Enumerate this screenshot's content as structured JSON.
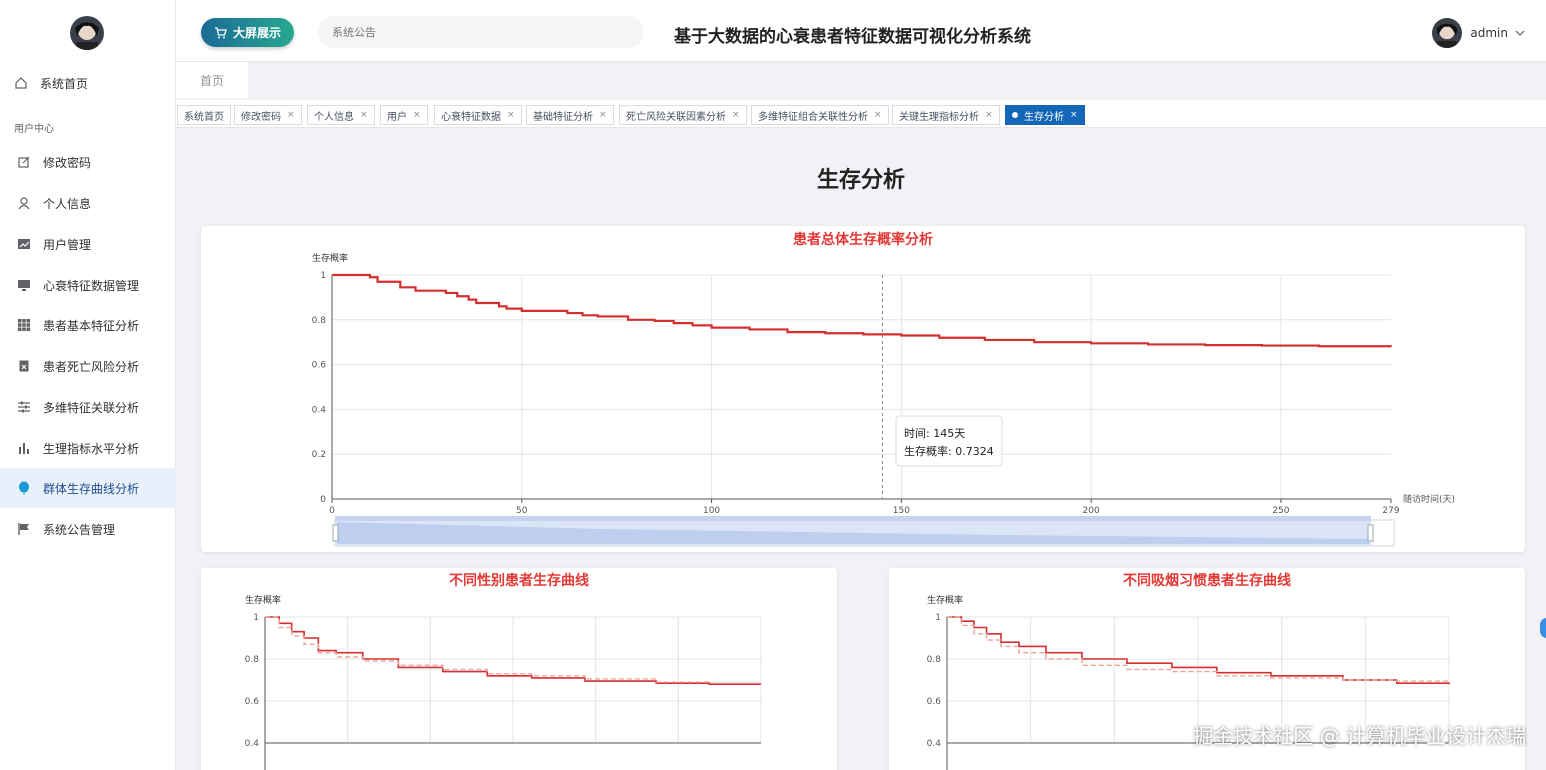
{
  "app": {
    "title": "基于大数据的心衰患者特征数据可视化分析系统",
    "bigscreen_label": "大屏展示",
    "notice_placeholder": "系统公告",
    "user": "admin",
    "home_tab": "首页",
    "page_title": "生存分析",
    "watermark": "掘金技术社区 @ 计算机毕业设计杰瑞"
  },
  "sidebar": {
    "group_label": "用户中心",
    "items": [
      {
        "label": "系统首页",
        "icon": "home-icon"
      },
      {
        "label": "修改密码",
        "icon": "edit-icon"
      },
      {
        "label": "个人信息",
        "icon": "user-icon"
      },
      {
        "label": "用户管理",
        "icon": "chart-line-icon"
      },
      {
        "label": "心衰特征数据管理",
        "icon": "monitor-icon"
      },
      {
        "label": "患者基本特征分析",
        "icon": "grid-icon"
      },
      {
        "label": "患者死亡风险分析",
        "icon": "clipboard-icon"
      },
      {
        "label": "多维特征关联分析",
        "icon": "sliders-icon"
      },
      {
        "label": "生理指标水平分析",
        "icon": "bar-chart-icon"
      },
      {
        "label": "群体生存曲线分析",
        "icon": "balloon-icon"
      },
      {
        "label": "系统公告管理",
        "icon": "flag-icon"
      }
    ],
    "active_index": 9
  },
  "tags": [
    {
      "label": "系统首页",
      "closable": false
    },
    {
      "label": "修改密码",
      "closable": true
    },
    {
      "label": "个人信息",
      "closable": true
    },
    {
      "label": "用户",
      "closable": true
    },
    {
      "label": "心衰特征数据",
      "closable": true
    },
    {
      "label": "基础特征分析",
      "closable": true
    },
    {
      "label": "死亡风险关联因素分析",
      "closable": true
    },
    {
      "label": "多维特征组合关联性分析",
      "closable": true
    },
    {
      "label": "关键生理指标分析",
      "closable": true
    },
    {
      "label": "生存分析",
      "closable": true,
      "active": true
    }
  ],
  "colors": {
    "accent": "#1466b8",
    "curve_red": "#d32f2f",
    "curve_dashed": "#e8a5a0",
    "title_red": "#e53935"
  },
  "chart_data": [
    {
      "type": "line",
      "title": "患者总体生存概率分析",
      "ylabel": "生存概率",
      "xlabel": "随访时间(天)",
      "xlim": [
        0,
        279
      ],
      "ylim": [
        0,
        1
      ],
      "xticks": [
        0,
        50,
        100,
        150,
        200,
        250,
        279
      ],
      "yticks": [
        0,
        0.2,
        0.4,
        0.6,
        0.8,
        1
      ],
      "series": [
        {
          "x": [
            0,
            10,
            12,
            18,
            22,
            30,
            33,
            36,
            38,
            44,
            46,
            50,
            62,
            66,
            70,
            78,
            85,
            90,
            95,
            100,
            110,
            120,
            130,
            140,
            150,
            160,
            172,
            185,
            200,
            215,
            230,
            245,
            260,
            279
          ],
          "y": [
            1.0,
            0.99,
            0.97,
            0.945,
            0.93,
            0.92,
            0.905,
            0.89,
            0.875,
            0.86,
            0.85,
            0.84,
            0.83,
            0.82,
            0.815,
            0.8,
            0.795,
            0.785,
            0.775,
            0.765,
            0.757,
            0.745,
            0.74,
            0.735,
            0.73,
            0.72,
            0.71,
            0.7,
            0.695,
            0.69,
            0.687,
            0.685,
            0.682,
            0.68
          ]
        }
      ],
      "tooltip": {
        "time_label": "时间: 145天",
        "prob_label": "生存概率: 0.7324",
        "x": 145
      }
    },
    {
      "type": "line",
      "title": "不同性别患者生存曲线",
      "ylabel": "生存概率",
      "ylim": [
        0.4,
        1
      ],
      "yticks": [
        0.4,
        0.6,
        0.8,
        1
      ],
      "series": [
        {
          "x": [
            0,
            8,
            15,
            22,
            30,
            40,
            55,
            75,
            100,
            125,
            150,
            180,
            220,
            250,
            279
          ],
          "y": [
            1.0,
            0.97,
            0.93,
            0.9,
            0.84,
            0.83,
            0.8,
            0.76,
            0.74,
            0.72,
            0.71,
            0.695,
            0.685,
            0.68,
            0.68
          ]
        },
        {
          "x": [
            0,
            8,
            15,
            22,
            30,
            40,
            55,
            75,
            100,
            125,
            150,
            180,
            220,
            250,
            279
          ],
          "y": [
            1.0,
            0.95,
            0.91,
            0.87,
            0.83,
            0.81,
            0.79,
            0.77,
            0.75,
            0.73,
            0.72,
            0.705,
            0.69,
            0.685,
            0.685
          ],
          "dashed": true
        }
      ]
    },
    {
      "type": "line",
      "title": "不同吸烟习惯患者生存曲线",
      "ylabel": "生存概率",
      "ylim": [
        0.4,
        1
      ],
      "yticks": [
        0.4,
        0.6,
        0.8,
        1
      ],
      "series": [
        {
          "x": [
            0,
            8,
            15,
            22,
            30,
            40,
            55,
            75,
            100,
            125,
            150,
            180,
            220,
            250,
            279
          ],
          "y": [
            1.0,
            0.98,
            0.95,
            0.92,
            0.88,
            0.86,
            0.83,
            0.8,
            0.78,
            0.76,
            0.735,
            0.72,
            0.7,
            0.685,
            0.68
          ]
        },
        {
          "x": [
            0,
            8,
            15,
            22,
            30,
            40,
            55,
            75,
            100,
            125,
            150,
            180,
            220,
            250,
            279
          ],
          "y": [
            1.0,
            0.96,
            0.92,
            0.89,
            0.86,
            0.83,
            0.8,
            0.77,
            0.75,
            0.74,
            0.72,
            0.71,
            0.7,
            0.695,
            0.69
          ],
          "dashed": true
        }
      ]
    }
  ]
}
